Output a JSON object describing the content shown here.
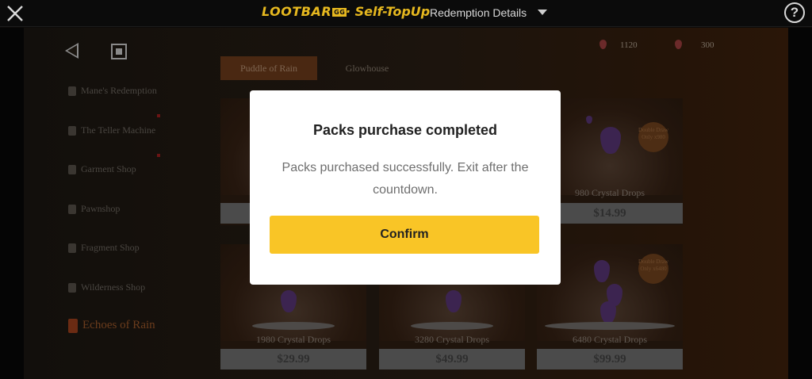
{
  "topbar": {
    "brand_name": "LOOTBAR",
    "brand_badge": "GG",
    "brand_sep": "·",
    "brand_tagline": "Self-TopUp",
    "page_title": "Redemption Details",
    "help_label": "?"
  },
  "currency": [
    {
      "amount": "1120"
    },
    {
      "amount": "300"
    }
  ],
  "tabs": [
    {
      "label": "Puddle of Rain"
    },
    {
      "label": "Glowhouse"
    }
  ],
  "menu": [
    {
      "label": "Mane's Redemption"
    },
    {
      "label": "The Teller Machine"
    },
    {
      "label": "Garment Shop"
    },
    {
      "label": "Pawnshop"
    },
    {
      "label": "Fragment Shop"
    },
    {
      "label": "Wilderness Shop"
    },
    {
      "label": "Echoes of Rain"
    }
  ],
  "cards": [
    {
      "name": "",
      "price": ""
    },
    {
      "name": "",
      "price": ""
    },
    {
      "name": "980 Crystal Drops",
      "price": "$14.99",
      "offer": "Double Draw Only x980"
    },
    {
      "name": "1980 Crystal Drops",
      "price": "$29.99"
    },
    {
      "name": "3280 Crystal Drops",
      "price": "$49.99"
    },
    {
      "name": "6480 Crystal Drops",
      "price": "$99.99",
      "offer": "Double Draw Only x6480"
    }
  ],
  "modal": {
    "title": "Packs purchase completed",
    "message": "Packs purchased successfully. Exit after the countdown.",
    "confirm_label": "Confirm"
  },
  "colors": {
    "accent": "#f9c526",
    "brand": "#e6b81f",
    "modal_bg": "#ffffff"
  }
}
